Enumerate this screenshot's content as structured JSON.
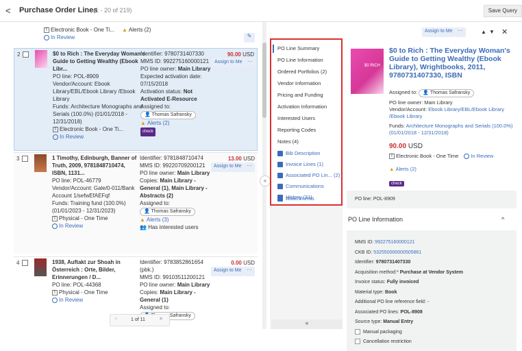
{
  "header": {
    "back": "<",
    "title": "Purchase Order Lines",
    "count": "(1 - 20 of 219)",
    "save_query": "Save Query"
  },
  "rows": [
    {
      "tail_format": "Electronic Book - One Ti...",
      "tail_alerts": "Alerts (2)",
      "tail_status": "In Review"
    },
    {
      "num": "2",
      "title": "$0 to Rich : The Everyday Woman's Guide to Getting Wealthy (Ebook Libr...",
      "po_line": "PO line: POL-8909",
      "vendor": "Vendor/Account: Ebook Library/EBL/Ebook Library /Ebook Library",
      "funds": "Funds: Architecture Monographs and Serials (100.0%) (01/01/2018 - 12/31/2018)",
      "format": "Electronic Book - One Ti...",
      "status": "In Review",
      "identifier": "Identifier: 9780731407330",
      "mms": "MMS ID: 992275160000121",
      "owner_label": "PO line owner: ",
      "owner": "Main Library",
      "expected": "Expected activation date: 07/15/2018",
      "activation_label": "Activation status: ",
      "activation": "Not Activated E-Resource",
      "assigned": "Assigned to:",
      "assignee": "Thomas Safransky",
      "alerts": "Alerts (2)",
      "check": "check",
      "price": "90.00",
      "currency": "USD",
      "assign_btn": "Assign to Me",
      "more": "···"
    },
    {
      "num": "3",
      "title": "1 Timothy, Edinburgh, Banner of Truth, 2009, 9781848710474, ISBN, 1131...",
      "po_line": "PO line: POL-46779",
      "vendor": "Vendor/Account: Gale/0-011/Bank Account 1/sefwEfAEFqf",
      "funds": "Funds: Training fund (100.0%) (01/01/2023 - 12/31/2023)",
      "format": "Physical - One Time",
      "status": "In Review",
      "identifier": "Identifier: 9781848710474",
      "mms": "MMS ID: 99220709200121",
      "owner_label": "PO line owner: ",
      "owner": "Main Library",
      "copies_label": "Copies: ",
      "copies": "Main Library - General (1), Main Library - Abstracts (2)",
      "assigned": "Assigned to:",
      "assignee": "Thomas Safransky",
      "alerts": "Alerts (3)",
      "interested": "Has interested users",
      "price": "13.00",
      "currency": "USD",
      "assign_btn": "Assign to Me",
      "more": "···"
    },
    {
      "num": "4",
      "title": "1938, Auftakt zur Shoah in Österreich : Orte, Bilder, Erinnerungen / D...",
      "po_line": "PO line: POL-44368",
      "format": "Physical - One Time",
      "status": "In Review",
      "identifier": "Identifier: 9783852861654 (pbk.)",
      "mms": "MMS ID: 99103511200121",
      "owner_label": "PO line owner: ",
      "owner": "Main Library",
      "copies_label": "Copies: ",
      "copies": "Main Library - General (1)",
      "assigned": "Assigned to:",
      "assignee": "Thomas Safransky",
      "price": "0.00",
      "currency": "USD",
      "assign_btn": "Assign to Me",
      "more": "···"
    }
  ],
  "pager": {
    "prev": "<",
    "label": "1 of 11",
    "next": ">"
  },
  "nav": {
    "items": [
      "PO Line Summary",
      "PO Line Information",
      "Ordered Portfolios (2)",
      "Vendor Information",
      "Pricing and Funding",
      "Activation Information",
      "Interested Users",
      "Reporting Codes",
      "Notes (4)"
    ],
    "links": [
      "Bib Description",
      "Invoice Lines (1)",
      "Associated PO Lin...  (2)",
      "Communications",
      "History (31)",
      "Attachments"
    ],
    "collapse": "«",
    "expand": "«"
  },
  "detail": {
    "assign_btn": "Assign to Me",
    "more": "···",
    "close": "✕",
    "cover_text": "$0 RICH",
    "title": "$0 to Rich : The Everyday Woman's Guide to Getting Wealthy (Ebook Library), Wrightbooks, 2011, 9780731407330, ISBN",
    "assigned_label": "Assigned to:",
    "assignee": "Thomas Safransky",
    "owner": "PO line owner: Main Library",
    "vendor_label": "Vendor/Account: ",
    "vendor": "Ebook Library/EBL/Ebook Library /Ebook Library",
    "funds_label": "Funds: ",
    "funds": "Architecture Monographs and Serials (100.0%) (01/01/2018 - 12/31/2018)",
    "price": "90.00",
    "currency": "USD",
    "format": "Electronic Book - One Time",
    "status": "In Review",
    "alerts": "Alerts (2)",
    "check": "check",
    "po_line": "PO line: POL-8909",
    "section_title": "PO Line Information",
    "info": {
      "mms_label": "MMS ID: ",
      "mms": "992275160000121",
      "ckb_label": "CKB ID: ",
      "ckb": "532550000000505861",
      "identifier_label": "Identifier: ",
      "identifier": "9780731407330",
      "acq_label": "Acquisition method:* ",
      "acq": "Purchase at Vendor System",
      "invoice_label": "Invoice status: ",
      "invoice": "Fully invoiced",
      "material_label": "Material type: ",
      "material": "Book",
      "addref_label": "Additional PO line reference field: -",
      "assoc_label": "Associated PO lines: ",
      "assoc": "POL-8908",
      "source_label": "Source type: ",
      "source": "Manual Entry",
      "manual_packaging": "Manual packaging",
      "cancellation": "Cancellation restriction"
    }
  },
  "colors": {
    "accent": "#3a6bb8",
    "price": "#c83030",
    "highlight_border": "#d93030",
    "check_badge": "#5a2a8a"
  }
}
